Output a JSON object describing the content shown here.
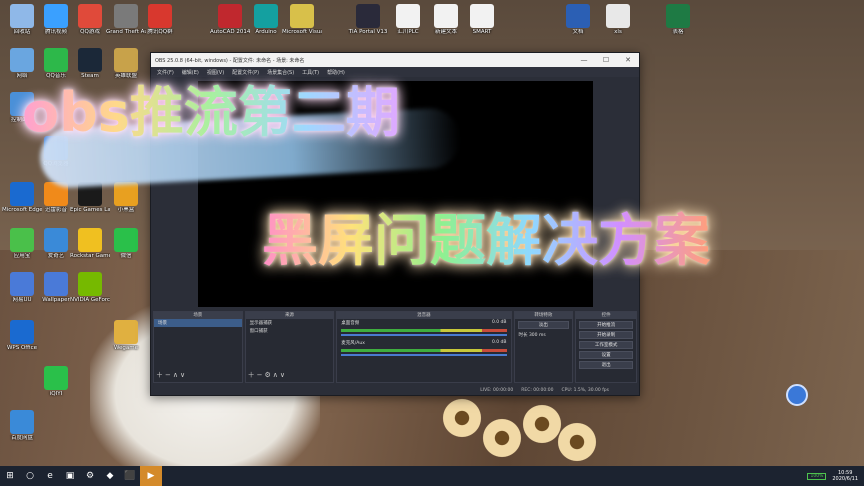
{
  "desktop": {
    "icons": [
      {
        "label": "回收站",
        "color": "#8fb8e8"
      },
      {
        "label": "腾讯视频",
        "color": "#3aa0ff"
      },
      {
        "label": "QQ游戏",
        "color": "#e04a3a"
      },
      {
        "label": "Grand Theft Auto V",
        "color": "#7a7a7a"
      },
      {
        "label": "腾讯QQ群",
        "color": "#d8382e"
      },
      {
        "label": "AutoCAD 2014 - 简体",
        "color": "#c0282e"
      },
      {
        "label": "Arduino",
        "color": "#14a0a0"
      },
      {
        "label": "Microsoft Visual C++",
        "color": "#d8c04a"
      },
      {
        "label": "TIA Portal V13",
        "color": "#2a2a3a"
      },
      {
        "label": "汇川PLC",
        "color": "#f2f2f2"
      },
      {
        "label": "新建文本",
        "color": "#f2f2f2"
      },
      {
        "label": "SMART",
        "color": "#f2f2f2"
      },
      {
        "label": "文档",
        "color": "#2b5fb4"
      },
      {
        "label": "xls",
        "color": "#e8e8e8"
      },
      {
        "label": "表格",
        "color": "#1e7a44"
      },
      {
        "label": "网络",
        "color": "#6aa6e0"
      },
      {
        "label": "QQ音乐",
        "color": "#2db84a"
      },
      {
        "label": "Steam",
        "color": "#1b2838"
      },
      {
        "label": "英雄联盟",
        "color": "#c8a24a"
      },
      {
        "label": "控制面板",
        "color": "#4a90d8"
      },
      {
        "label": "QQ浏览器",
        "color": "#2a7ad8"
      },
      {
        "label": "Microsoft Edge",
        "color": "#1a6ad0"
      },
      {
        "label": "迅雷影音",
        "color": "#f08a1a"
      },
      {
        "label": "Epic Games Launcher",
        "color": "#1a1a1a"
      },
      {
        "label": "小黑盒",
        "color": "#e8a020"
      },
      {
        "label": "应用宝",
        "color": "#4ac04a"
      },
      {
        "label": "爱奇艺",
        "color": "#3a8ad8"
      },
      {
        "label": "Rockstar Games",
        "color": "#f0c020"
      },
      {
        "label": "微信",
        "color": "#2ac04a"
      },
      {
        "label": "网易UU",
        "color": "#4a7ad8"
      },
      {
        "label": "Wallpaper",
        "color": "#4a7ad8"
      },
      {
        "label": "NVIDIA GeForce",
        "color": "#76b900"
      },
      {
        "label": "WPS Office",
        "color": "#1a6ad0"
      },
      {
        "label": "iQIYI",
        "color": "#2ac04a"
      },
      {
        "label": "百度网盘",
        "color": "#3a8ad8"
      },
      {
        "label": "Wegame",
        "color": "#e0b040"
      }
    ]
  },
  "obs": {
    "title": "OBS 25.0.8 (64-bit, windows) - 配置文件: 未命名 - 场景: 未命名",
    "menu": [
      "文件(F)",
      "编辑(E)",
      "视图(V)",
      "配置文件(P)",
      "场景集合(S)",
      "工具(T)",
      "帮助(H)"
    ],
    "window_buttons": [
      "—",
      "☐",
      "✕"
    ],
    "docks": {
      "scenes": {
        "title": "场景",
        "items": [
          "场景"
        ]
      },
      "sources": {
        "title": "来源",
        "items": [
          "显示器捕获",
          "窗口捕获"
        ]
      },
      "mixer": {
        "title": "混音器",
        "tracks": [
          {
            "name": "桌面音频",
            "db": "0.0 dB"
          },
          {
            "name": "麦克风/Aux",
            "db": "0.0 dB"
          }
        ]
      },
      "transitions": {
        "title": "转场特效",
        "mode": "淡出",
        "duration_label": "时长",
        "duration": "300 ms"
      },
      "controls": {
        "title": "控件",
        "buttons": [
          "开始推流",
          "开始录制",
          "工作室模式",
          "设置",
          "退出"
        ]
      }
    },
    "status": {
      "live": "LIVE: 00:00:00",
      "rec": "REC: 00:00:00",
      "cpu": "CPU: 1.5%, 30.00 fps"
    }
  },
  "overlay": {
    "line1": "obs推流第二期",
    "line2": "黑屏问题解决方案"
  },
  "taskbar": {
    "items": [
      "⊞",
      "○",
      "e",
      "▣",
      "⚙",
      "◆",
      "⬛",
      "▶"
    ],
    "battery": "100%",
    "time": "10:59",
    "date": "2020/6/11"
  }
}
